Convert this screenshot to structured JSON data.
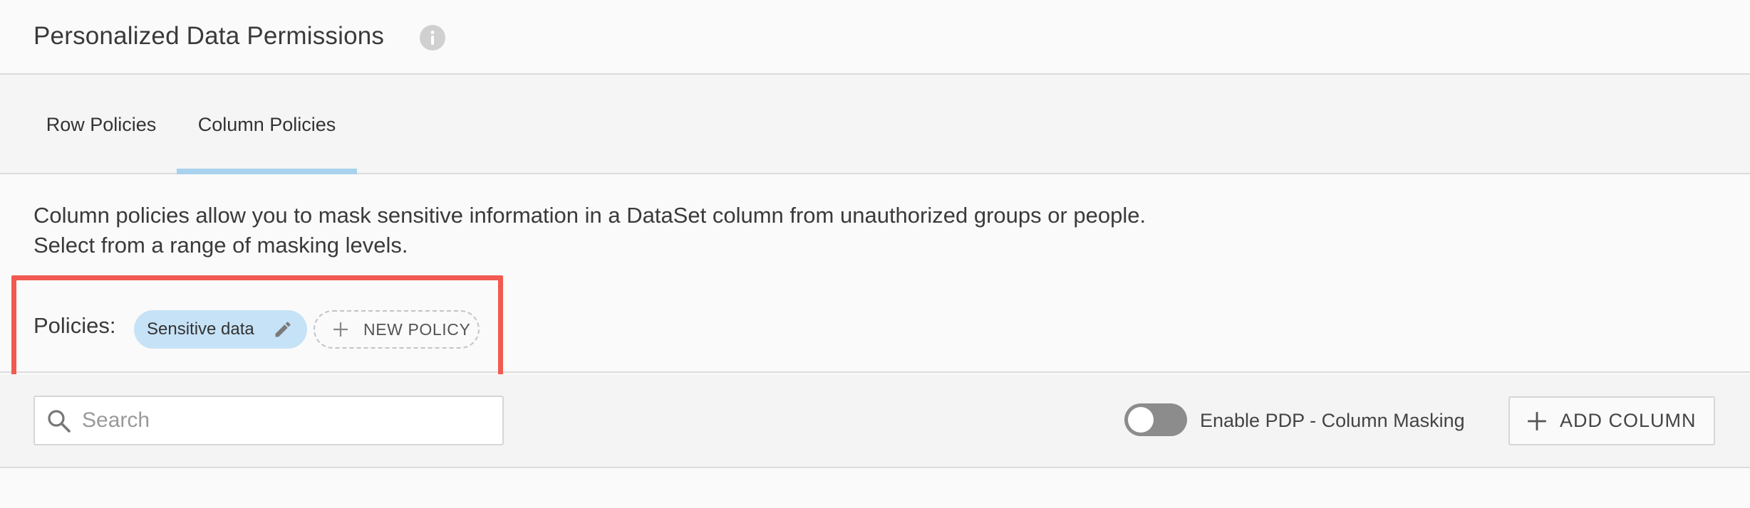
{
  "header": {
    "title": "Personalized Data Permissions",
    "info_icon": "info-icon"
  },
  "tabs": [
    {
      "label": "Row Policies",
      "active": false
    },
    {
      "label": "Column Policies",
      "active": true
    }
  ],
  "description": {
    "line1": "Column policies allow you to mask sensitive information in a DataSet column from unauthorized groups or people.",
    "line2": "Select from a range of masking levels."
  },
  "policies": {
    "label": "Policies:",
    "items": [
      {
        "label": "Sensitive data",
        "icon": "pencil-icon"
      }
    ],
    "new_policy_label": "NEW POLICY"
  },
  "toolbar": {
    "search_placeholder": "Search",
    "search_value": "",
    "toggle_label": "Enable PDP - Column Masking",
    "toggle_on": false,
    "add_column_label": "ADD COLUMN"
  },
  "colors": {
    "accent_tab": "#a8d2ee",
    "chip_bg": "#c6e2f6",
    "highlight": "#f15a50",
    "toggle_off": "#8c8c8c"
  }
}
